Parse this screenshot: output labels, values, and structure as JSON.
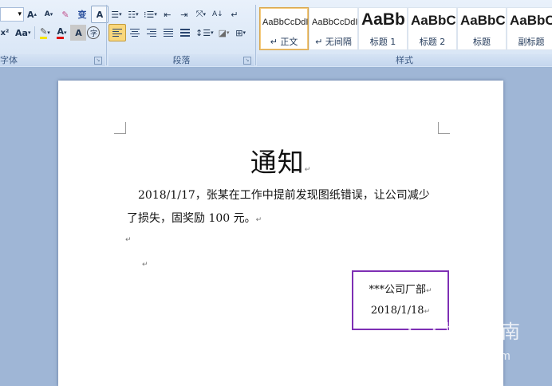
{
  "ribbon": {
    "font_group": {
      "label": "字体",
      "grow_font": "A",
      "shrink_font": "A",
      "phonetic": "变",
      "border_char": "A",
      "superscript": "x²",
      "change_case": "Aa",
      "font_color_letter": "A",
      "char_shading": "A",
      "enclose_char": "字"
    },
    "paragraph_group": {
      "label": "段落"
    },
    "styles_group": {
      "label": "样式",
      "items": [
        {
          "sample": "AaBbCcDdI",
          "name": "↵ 正文",
          "selected": true
        },
        {
          "sample": "AaBbCcDdI",
          "name": "↵ 无间隔",
          "selected": false
        },
        {
          "sample": "AaBb",
          "name": "标题 1",
          "selected": false
        },
        {
          "sample": "AaBbC",
          "name": "标题 2",
          "selected": false
        },
        {
          "sample": "AaBbC",
          "name": "标题",
          "selected": false
        },
        {
          "sample": "AaBbC",
          "name": "副标题",
          "selected": false
        }
      ]
    }
  },
  "document": {
    "title": "通知",
    "body_line1": "2018/1/17，张某在工作中提前发现图纸错误，让公司减少",
    "body_line2": "了损失，固奖励 100 元。",
    "signature_company": "***公司厂部",
    "signature_date": "2018/1/18",
    "paragraph_mark": "↵"
  },
  "watermark": {
    "text_cn": "搜狗指南",
    "text_en": "zhinan.sogou.com"
  },
  "colors": {
    "highlight": "#f5e400",
    "font_color": "#e01010",
    "annotation_box": "#7e2fb4"
  }
}
